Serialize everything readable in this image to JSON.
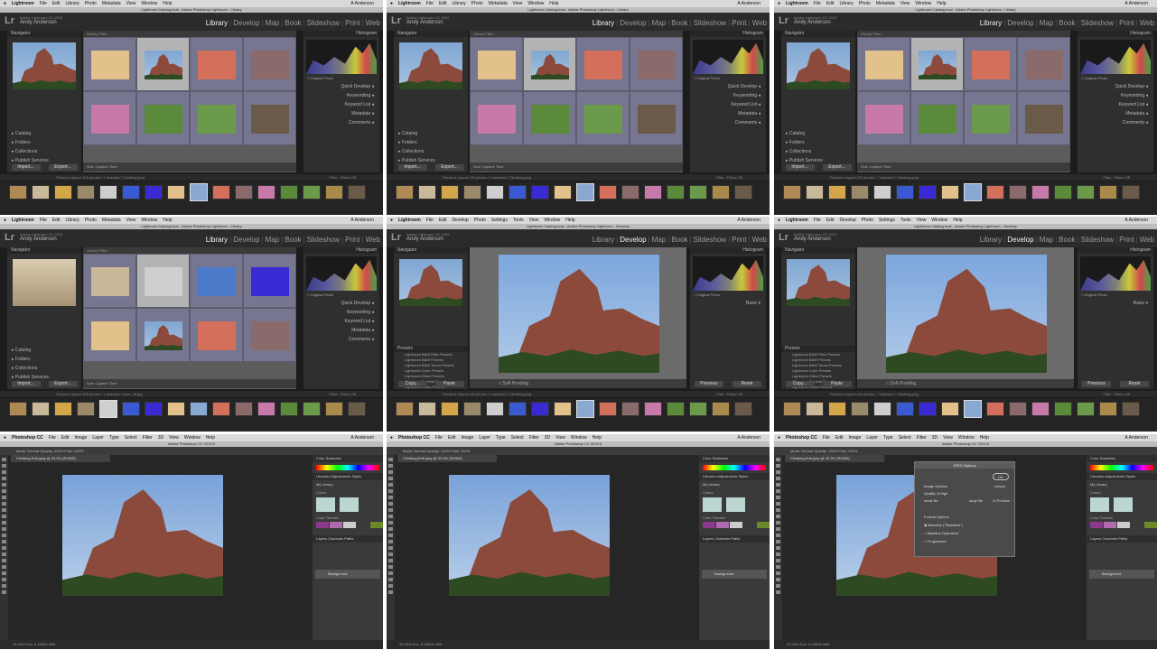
{
  "lightroom": {
    "menu": [
      "Lightroom",
      "File",
      "Edit",
      "Library",
      "Photo",
      "Metadata",
      "View",
      "Window",
      "Help"
    ],
    "dev_menu": [
      "Lightroom",
      "File",
      "Edit",
      "Develop",
      "Photo",
      "Settings",
      "Tools",
      "View",
      "Window",
      "Help"
    ],
    "user": "A Anderson",
    "catalog_title_library": "Lightroom Catalog.lrcat - Adobe Photoshop Lightroom - Library",
    "catalog_title_develop": "Lightroom Catalog.lrcat - Adobe Photoshop Lightroom - Develop",
    "identity_line1": "Adobe Lightroom CC 2015",
    "identity_line2": "Andy Anderson",
    "modules": [
      "Library",
      "Develop",
      "Map",
      "Book",
      "Slideshow",
      "Print",
      "Web"
    ],
    "navigator": "Navigator",
    "library_filter": "Library Filter :",
    "left_sections": [
      "Catalog",
      "Folders",
      "Collections",
      "Publish Services"
    ],
    "import_btn": "Import...",
    "export_btn": "Export...",
    "copy_btn": "Copy...",
    "paste_btn": "Paste",
    "histogram": "Histogram",
    "original_photo": "Original Photo",
    "right_sections": [
      "Quick Develop",
      "Keywording",
      "Keyword List",
      "Metadata",
      "Comments"
    ],
    "sort": "Sort: Capture Time",
    "thumbnails": "Thumbnails",
    "filmstrip_info": "Previous Import   100 photos / 1 selected / Climbing.jpeg",
    "filmstrip_info2": "Previous Import   100 photos / 1 selected / Door_08.jpg",
    "filter": "Filter :",
    "filter_value": "Filters Off",
    "presets": "Presets",
    "preset_items": [
      "Lightroom B&W Filter Presets",
      "Lightroom B&W Presets",
      "Lightroom B&W Toned Presets",
      "Lightroom Color Presets",
      "Lightroom Effect Presets",
      "Lightroom General Presets",
      "Lightroom Video Presets"
    ],
    "soft_proofing": "Soft Proofing",
    "previous_btn": "Previous",
    "reset_btn": "Reset",
    "basic": "Basic"
  },
  "photoshop": {
    "menu": [
      "Photoshop CC",
      "File",
      "Edit",
      "Image",
      "Layer",
      "Type",
      "Select",
      "Filter",
      "3D",
      "View",
      "Window",
      "Help"
    ],
    "user": "A Anderson",
    "title": "Adobe Photoshop CC 2015.5",
    "doc_tab": "Climbing-Edit.jpeg @ 33.3% (RGB/8)",
    "options": "Mode: Normal   Opacity: 100%   Flow: 100%",
    "panels": {
      "color": "Color",
      "swatches": "Swatches",
      "libraries": "Libraries",
      "adjustments": "Adjustments",
      "styles": "Styles",
      "my_library": "My Library",
      "colors": "Colors",
      "color_themes": "Color Themes",
      "layers": "Layers",
      "channels": "Channels",
      "paths": "Paths",
      "background": "Background"
    },
    "status": "33.33%   Doc: 5.49M/5.49M",
    "dialog": {
      "title": "JPEG Options",
      "ok": "OK",
      "cancel": "Cancel",
      "preview": "Preview",
      "image_options": "Image Options",
      "quality_label": "Quality:",
      "quality_value": "8",
      "quality_level": "High",
      "small_file": "small file",
      "large_file": "large file",
      "format_options": "Format Options",
      "baseline_standard": "Baseline (\"Standard\")",
      "baseline_optimized": "Baseline Optimized",
      "progressive": "Progressive"
    }
  }
}
